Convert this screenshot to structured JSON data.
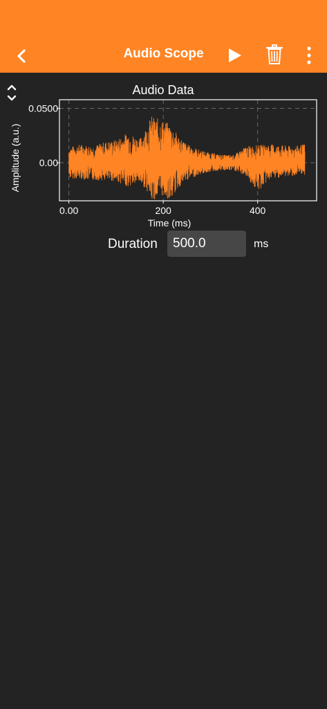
{
  "appbar": {
    "title": "Audio Scope",
    "color": "#ff8424",
    "icons": [
      "back-icon",
      "play-icon",
      "trash-icon",
      "more-vertical-icon"
    ]
  },
  "controls": {
    "expand_icon": "chevron-up-down-icon"
  },
  "chart_data": {
    "type": "line",
    "title": "Audio Data",
    "xlabel": "Time (ms)",
    "ylabel": "Amplitude (a.u.)",
    "xlim": [
      -20,
      525
    ],
    "ylim": [
      -0.035,
      0.058
    ],
    "x_ticks": [
      "0.00",
      "200",
      "400"
    ],
    "x_tick_values": [
      0,
      200,
      400
    ],
    "y_ticks": [
      "0.00",
      "0.0500"
    ],
    "y_tick_values": [
      0,
      0.05
    ],
    "grid": true,
    "color": "#ff8424",
    "series": [
      {
        "x": [
          0,
          25,
          50,
          75,
          100,
          125,
          150,
          165,
          175,
          185,
          200,
          215,
          230,
          250,
          275,
          300,
          325,
          350,
          375,
          400,
          425,
          450,
          475,
          500
        ],
        "upper": [
          0.014,
          0.017,
          0.015,
          0.019,
          0.021,
          0.028,
          0.022,
          0.034,
          0.043,
          0.041,
          0.039,
          0.035,
          0.026,
          0.017,
          0.012,
          0.009,
          0.007,
          0.007,
          0.015,
          0.016,
          0.017,
          0.016,
          0.015,
          0.017
        ],
        "lower": [
          -0.014,
          -0.015,
          -0.016,
          -0.016,
          -0.017,
          -0.022,
          -0.018,
          -0.025,
          -0.035,
          -0.033,
          -0.03,
          -0.035,
          -0.024,
          -0.016,
          -0.011,
          -0.008,
          -0.007,
          -0.007,
          -0.012,
          -0.027,
          -0.015,
          -0.013,
          -0.012,
          -0.011
        ]
      }
    ]
  },
  "duration": {
    "label": "Duration",
    "value": "500.0",
    "unit": "ms"
  }
}
